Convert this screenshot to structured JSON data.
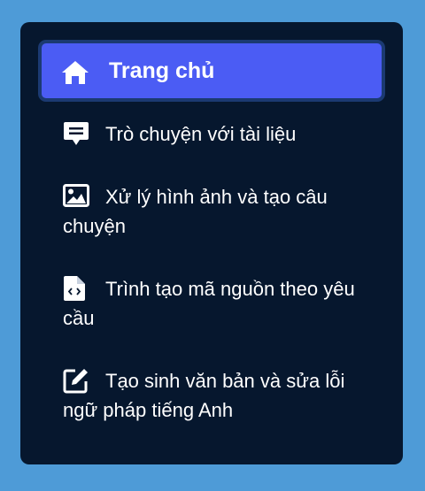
{
  "sidebar": {
    "items": [
      {
        "label": "Trang chủ",
        "icon": "home-icon",
        "active": true
      },
      {
        "label": "Trò chuyện với tài liệu",
        "icon": "comment-icon",
        "active": false
      },
      {
        "label": "Xử lý hình ảnh và tạo câu chuyện",
        "icon": "image-icon",
        "active": false
      },
      {
        "label": "Trình tạo mã nguồn theo yêu cầu",
        "icon": "file-code-icon",
        "active": false
      },
      {
        "label": "Tạo sinh văn bản và sửa lỗi ngữ pháp tiếng Anh",
        "icon": "edit-icon",
        "active": false
      }
    ],
    "colors": {
      "background": "#06172e",
      "active_background": "#4b5cf4",
      "page_background": "#4e9bd7"
    }
  }
}
